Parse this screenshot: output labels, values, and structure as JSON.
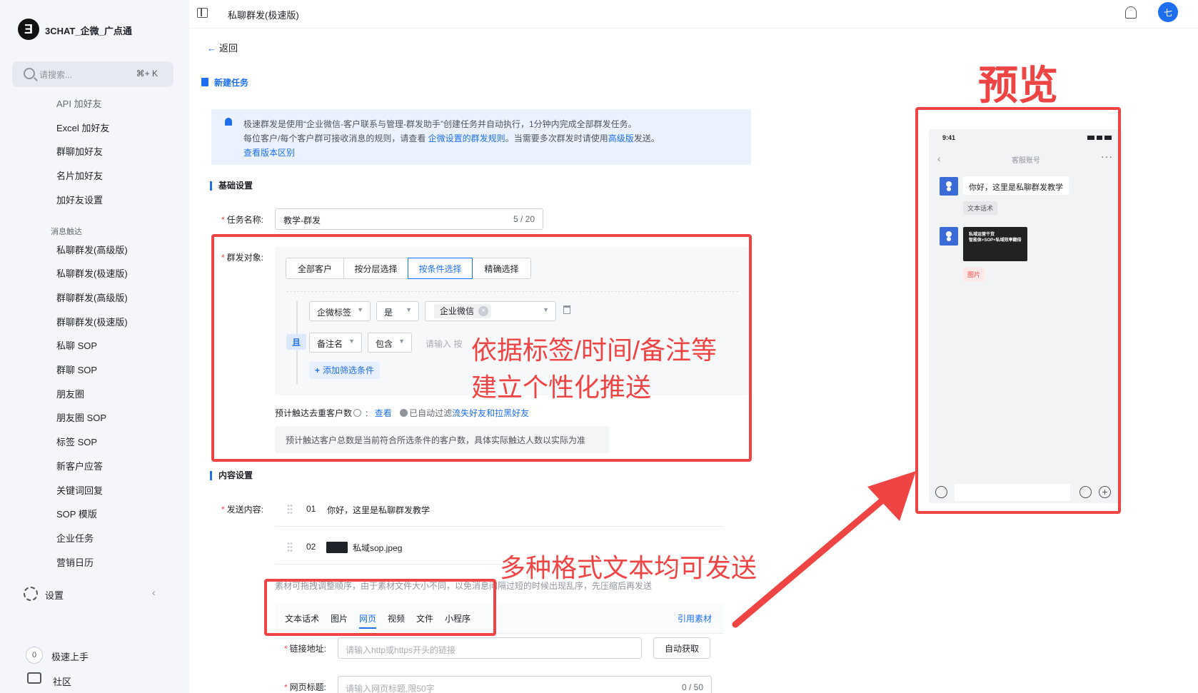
{
  "app": {
    "brand": "3CHAT_企微_广点通",
    "logo_glyph": "Ǝ"
  },
  "search": {
    "placeholder": "请搜索...",
    "shortcut": "⌘+ K"
  },
  "sidebar": {
    "items_top": [
      "API 加好友",
      "Excel 加好友",
      "群聊加好友",
      "名片加好友",
      "加好友设置"
    ],
    "section_title": "消息触达",
    "items_msg": [
      "私聊群发(高级版)",
      "私聊群发(极速版)",
      "群聊群发(高级版)",
      "群聊群发(极速版)",
      "私聊 SOP",
      "群聊 SOP",
      "朋友圈",
      "朋友圈 SOP",
      "标签 SOP",
      "新客户应答",
      "关键词回复",
      "SOP 模版",
      "企业任务",
      "营销日历"
    ],
    "settings": "设置",
    "quick_badge": "0",
    "quick_start": "极速上手",
    "community": "社区"
  },
  "topbar": {
    "page_title": "私聊群发(极速版)",
    "avatar_letter": "七"
  },
  "main": {
    "back": "返回",
    "new_task": "新建任务",
    "notice": {
      "line1": "极速群发是使用“企业微信-客户联系与管理-群发助手”创建任务并自动执行，1分钟内完成全部群发任务。",
      "line2_a": "每位客户/每个客户群可接收消息的规则，请查看 ",
      "line2_link": "企微设置的群发规则",
      "line2_b": "。当需要多次群发时请使用",
      "line2_link2": "高级版",
      "line2_c": "发送。",
      "line3_link": "查看版本区别"
    },
    "basic_settings": "基础设置",
    "task_name_label": "任务名称:",
    "task_name_value": "教学-群发",
    "task_name_count": "5 / 20",
    "target_label": "群发对象:",
    "segments": [
      "全部客户",
      "按分层选择",
      "按条件选择",
      "精确选择"
    ],
    "active_segment": "按条件选择",
    "conditions": {
      "and_label": "且",
      "row1": {
        "field": "企微标签",
        "op": "是",
        "tag": "企业微信"
      },
      "row2": {
        "field": "备注名",
        "op": "包含",
        "placeholder": "请输入 按"
      },
      "add_filter": "添加筛选条件"
    },
    "estimate": {
      "label": "预计触达去重客户数",
      "colon": ":",
      "view": "查看",
      "auto_filter_a": "已自动过滤",
      "auto_filter_link": "流失好友和拉黑好友"
    },
    "hint": "预计触达客户总数是当前符合所选条件的客户数，具体实际触达人数以实际为准",
    "content_settings": "内容设置",
    "send_content_label": "发送内容:",
    "contents": [
      {
        "num": "01",
        "text": "你好，这里是私聊群发教学"
      },
      {
        "num": "02",
        "text": "私域sop.jpeg"
      }
    ],
    "sort_tip": "素材可拖拽调整顺序，由于素材文件大小不同，以免消息间隔过短的时候出现乱序，先压缩后再发送",
    "type_tabs": [
      "文本话术",
      "图片",
      "网页",
      "视频",
      "文件",
      "小程序"
    ],
    "active_type": "网页",
    "ref_material": "引用素材",
    "link_label": "链接地址:",
    "link_placeholder": "请输入http或https开头的链接",
    "auto_fetch": "自动获取",
    "web_title_label": "网页标题:",
    "web_title_placeholder": "请输入网页标题,限50字",
    "web_title_count": "0 / 50"
  },
  "preview": {
    "label": "预览",
    "time": "9:41",
    "title": "客服账号",
    "msg1": "你好，这里是私聊群发教学",
    "tag1": "文本话术",
    "img_caption1": "私域运营干货",
    "img_caption2": "智能体+SOP+私域效率翻倍",
    "tag2": "图片"
  },
  "annotations": {
    "conditions_1": "依据标签/时间/备注等",
    "conditions_2": "建立个性化推送",
    "formats": "多种格式文本均可发送"
  },
  "colors": {
    "accent": "#1e6ff0",
    "annotation_red": "#ef4444",
    "required": "#f54a45"
  }
}
